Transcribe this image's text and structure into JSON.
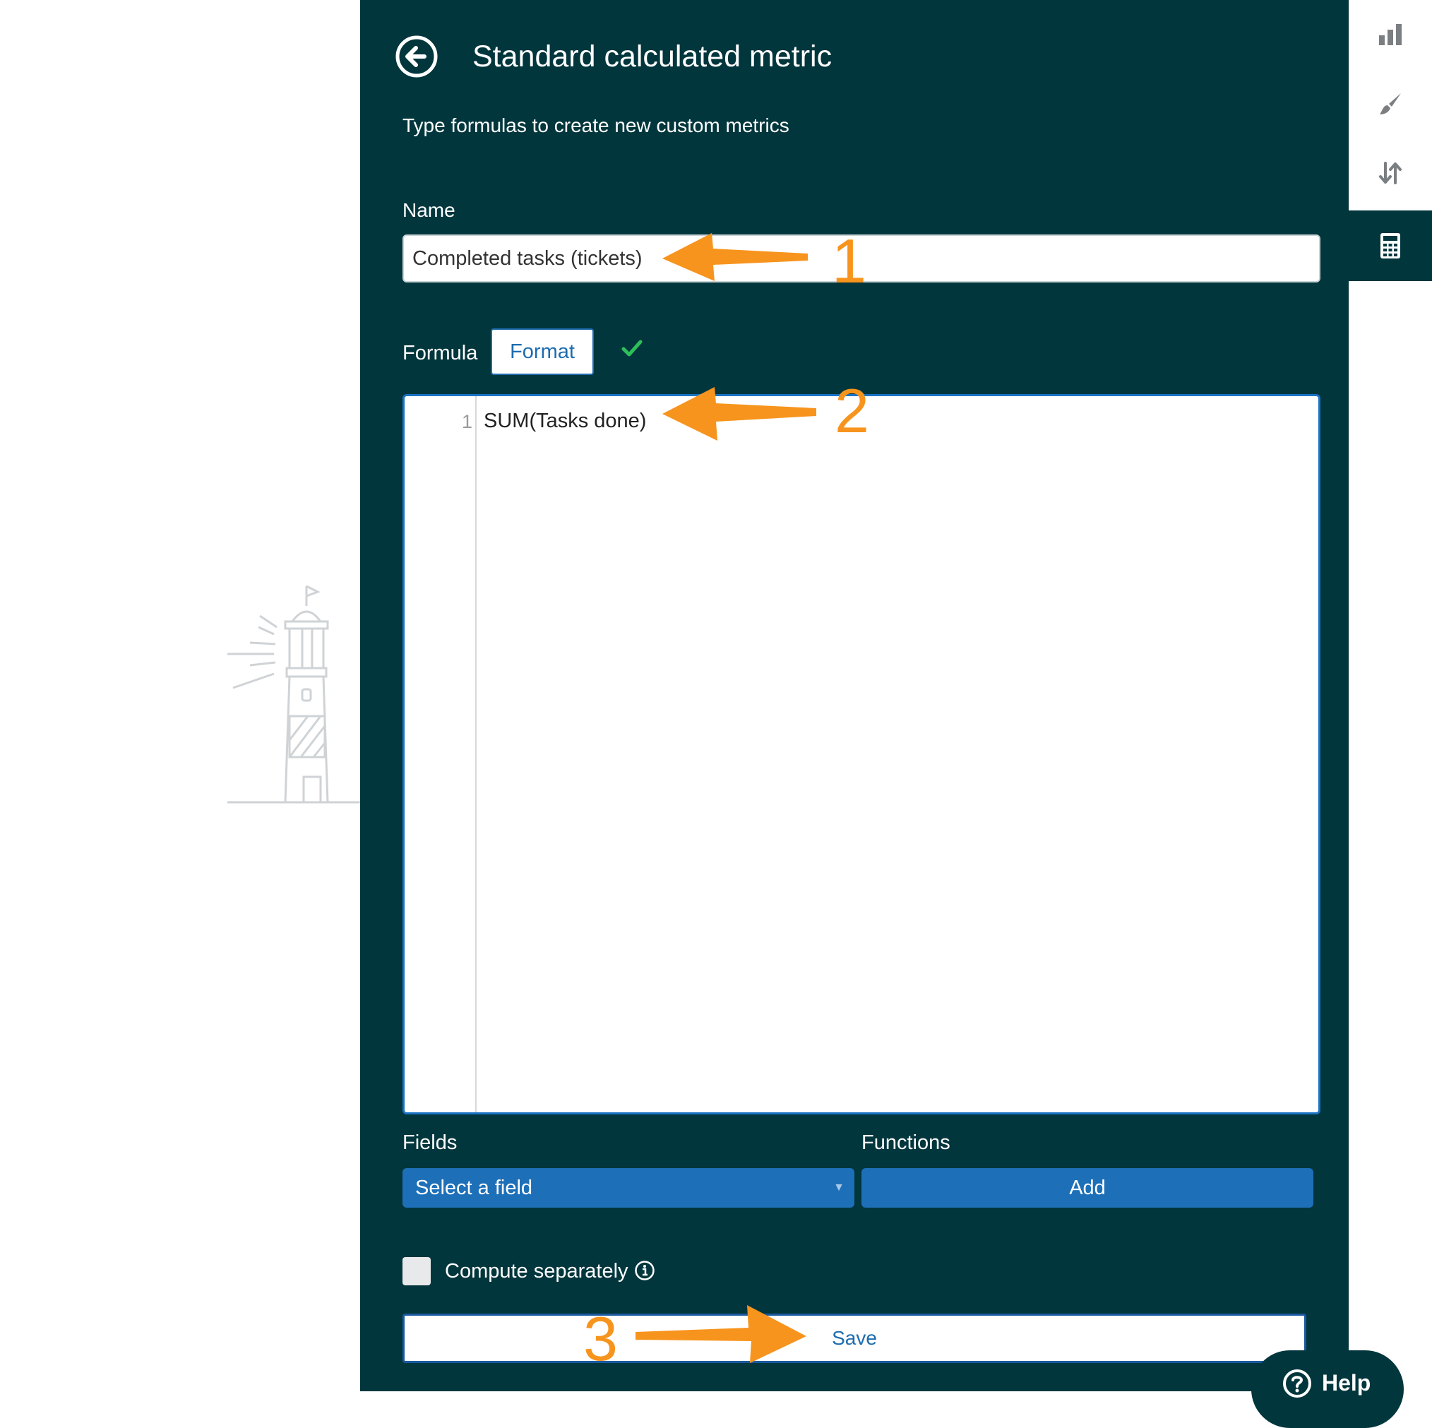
{
  "header": {
    "title": "Standard calculated metric",
    "subtitle": "Type formulas to create new custom metrics"
  },
  "name": {
    "label": "Name",
    "value": "Completed tasks (tickets)"
  },
  "formula": {
    "label": "Formula",
    "format_button": "Format",
    "line_number": "1",
    "code": "SUM(Tasks done)",
    "valid_icon": "check-icon"
  },
  "fields": {
    "label": "Fields",
    "select_placeholder": "Select a field"
  },
  "functions": {
    "label": "Functions",
    "add_button": "Add"
  },
  "compute": {
    "label": "Compute separately",
    "checked": false
  },
  "save_button": "Save",
  "help_button": "Help",
  "sidebar_icons": [
    "bar-chart-icon",
    "brush-icon",
    "sort-icon",
    "calculator-icon"
  ],
  "annotations": [
    "1",
    "2",
    "3"
  ],
  "colors": {
    "panel": "#02363d",
    "accent_blue": "#1d6fb8",
    "annotation_orange": "#f7941d",
    "check_green": "#2ebf5a"
  }
}
